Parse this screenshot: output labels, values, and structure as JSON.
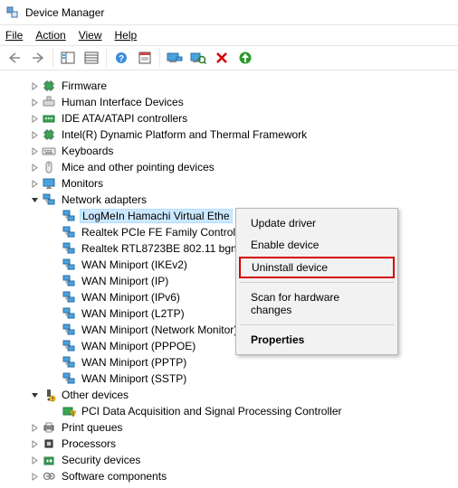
{
  "title": "Device Manager",
  "menubar": [
    "File",
    "Action",
    "View",
    "Help"
  ],
  "tree": {
    "root_items": [
      {
        "label": "Firmware",
        "icon": "chip",
        "expander": "right"
      },
      {
        "label": "Human Interface Devices",
        "icon": "hid",
        "expander": "right"
      },
      {
        "label": "IDE ATA/ATAPI controllers",
        "icon": "ide",
        "expander": "right"
      },
      {
        "label": "Intel(R) Dynamic Platform and Thermal Framework",
        "icon": "chip",
        "expander": "right"
      },
      {
        "label": "Keyboards",
        "icon": "keyboard",
        "expander": "right"
      },
      {
        "label": "Mice and other pointing devices",
        "icon": "mouse",
        "expander": "right"
      },
      {
        "label": "Monitors",
        "icon": "monitor",
        "expander": "right"
      },
      {
        "label": "Network adapters",
        "icon": "network",
        "expander": "down",
        "children": "network"
      },
      {
        "label": "Other devices",
        "icon": "other",
        "expander": "down",
        "children": "other"
      },
      {
        "label": "Print queues",
        "icon": "printer",
        "expander": "right"
      },
      {
        "label": "Processors",
        "icon": "cpu",
        "expander": "right"
      },
      {
        "label": "Security devices",
        "icon": "security",
        "expander": "right"
      },
      {
        "label": "Software components",
        "icon": "software",
        "expander": "right"
      }
    ],
    "network_children": [
      {
        "label": "LogMeIn Hamachi Virtual Ethe",
        "icon": "network",
        "selected": true
      },
      {
        "label": "Realtek PCIe FE Family Control",
        "icon": "network"
      },
      {
        "label": "Realtek RTL8723BE 802.11 bgn V",
        "icon": "network"
      },
      {
        "label": "WAN Miniport (IKEv2)",
        "icon": "network"
      },
      {
        "label": "WAN Miniport (IP)",
        "icon": "network"
      },
      {
        "label": "WAN Miniport (IPv6)",
        "icon": "network"
      },
      {
        "label": "WAN Miniport (L2TP)",
        "icon": "network"
      },
      {
        "label": "WAN Miniport (Network Monitor)",
        "icon": "network"
      },
      {
        "label": "WAN Miniport (PPPOE)",
        "icon": "network"
      },
      {
        "label": "WAN Miniport (PPTP)",
        "icon": "network"
      },
      {
        "label": "WAN Miniport (SSTP)",
        "icon": "network"
      }
    ],
    "other_children": [
      {
        "label": "PCI Data Acquisition and Signal Processing Controller",
        "icon": "warn"
      }
    ]
  },
  "context_menu": {
    "update": "Update driver",
    "enable": "Enable device",
    "uninstall": "Uninstall device",
    "scan": "Scan for hardware changes",
    "properties": "Properties"
  }
}
